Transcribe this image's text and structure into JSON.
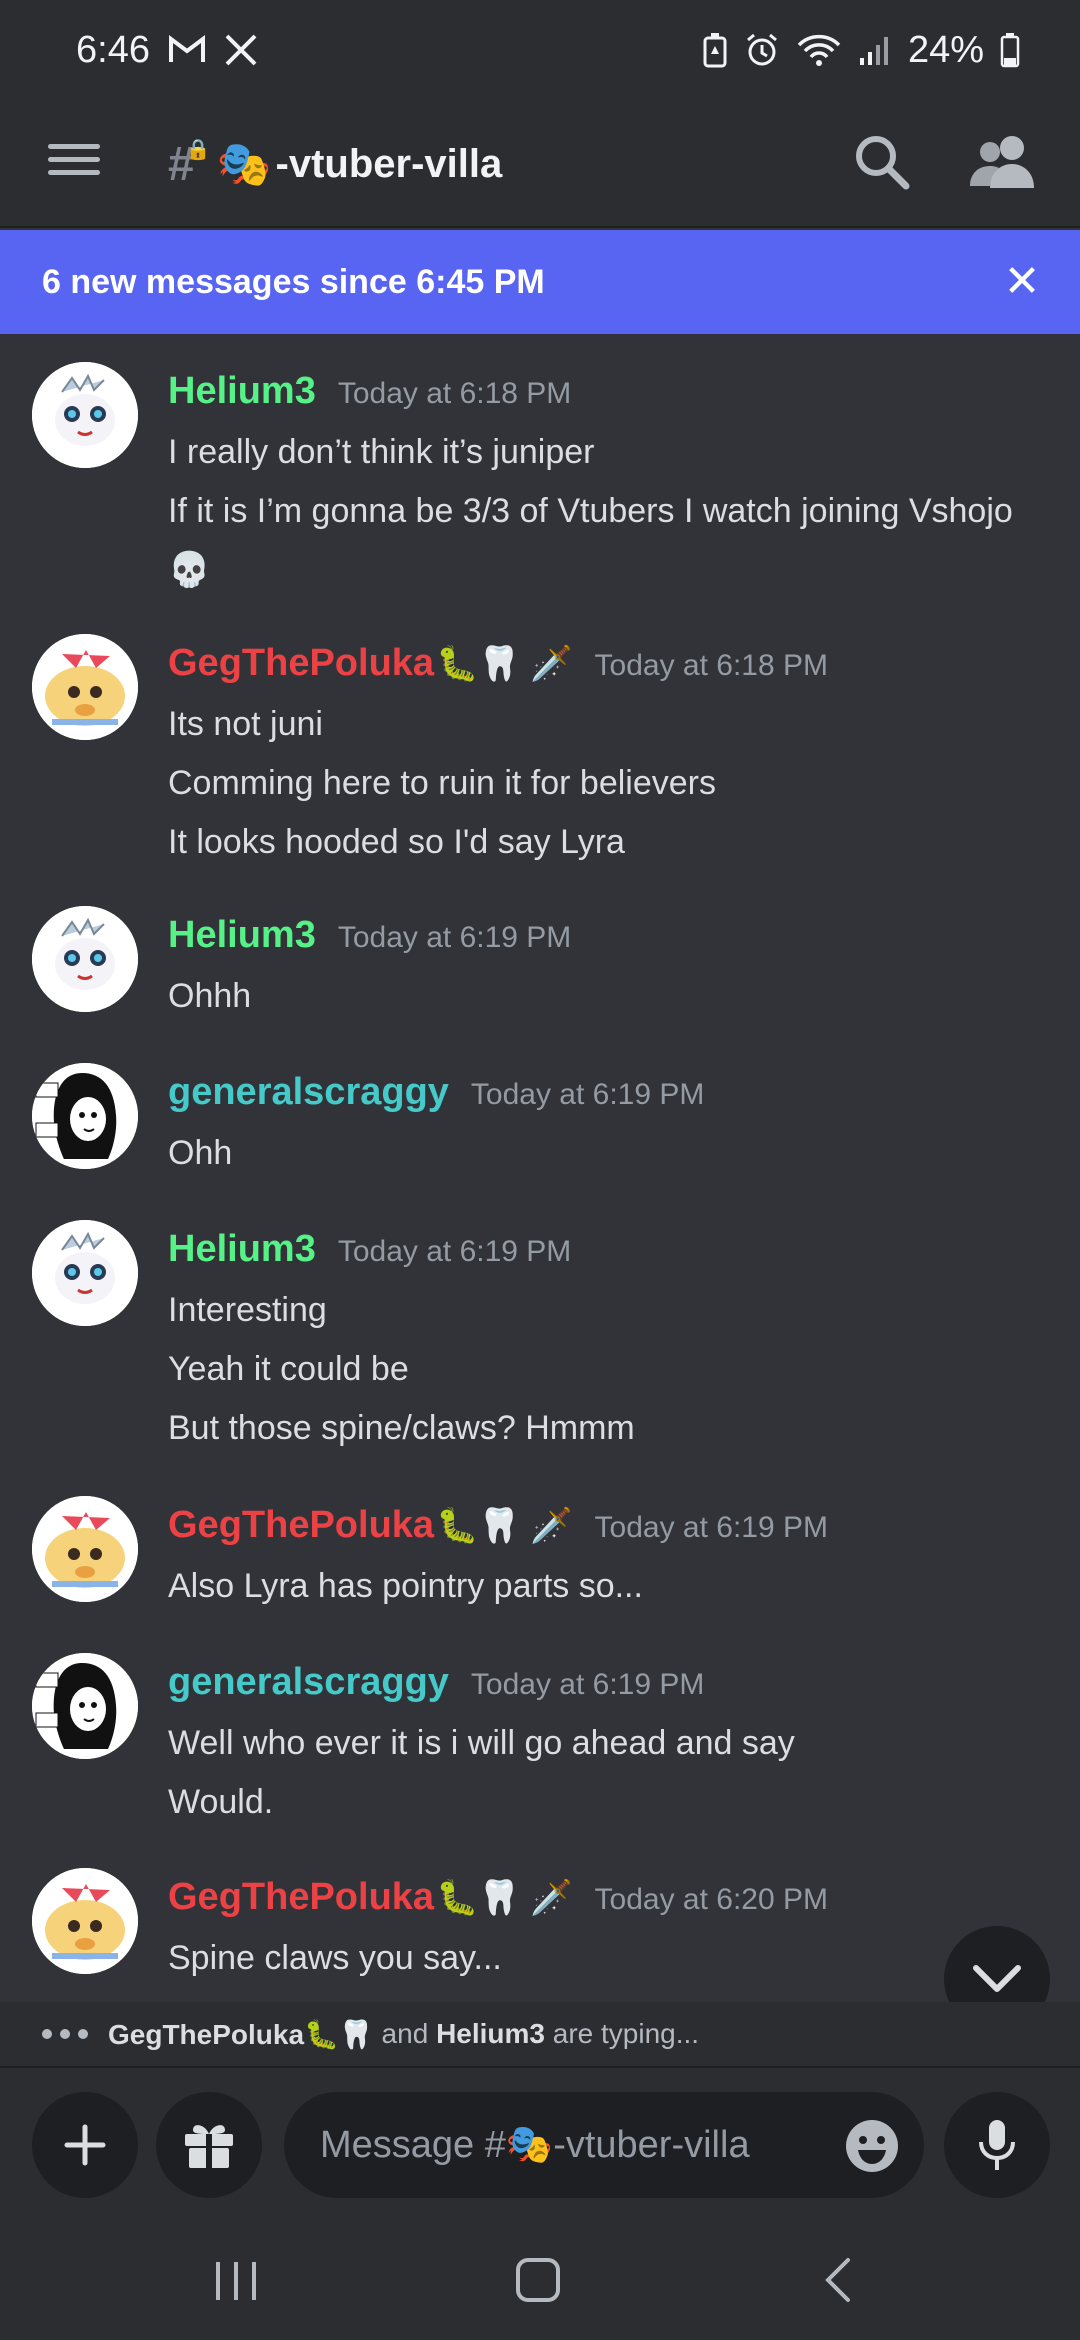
{
  "status_bar": {
    "time": "6:46",
    "battery": "24%"
  },
  "header": {
    "channel_prefix": "#",
    "channel_emoji": "🎭",
    "channel_name": "-vtuber-villa"
  },
  "banner": {
    "text": "6 new messages since 6:45 PM"
  },
  "messages": [
    {
      "user": "Helium3",
      "badges": "",
      "time": "Today at 6:18 PM",
      "lines": [
        "I really don’t think it’s juniper",
        "If it is I’m gonna be 3/3 of Vtubers I watch joining Vshojo",
        "💀"
      ]
    },
    {
      "user": "GegThePoluka",
      "badges": "🐛🦷 🗡️",
      "time": "Today at 6:18 PM",
      "lines": [
        "Its not juni",
        "Comming here to ruin it for believers",
        "It looks hooded so I'd say Lyra"
      ]
    },
    {
      "user": "Helium3",
      "badges": "",
      "time": "Today at 6:19 PM",
      "lines": [
        "Ohhh"
      ]
    },
    {
      "user": "generalscraggy",
      "badges": "",
      "time": "Today at 6:19 PM",
      "lines": [
        "Ohh"
      ]
    },
    {
      "user": "Helium3",
      "badges": "",
      "time": "Today at 6:19 PM",
      "lines": [
        "Interesting",
        "Yeah it could be",
        "But those spine/claws? Hmmm"
      ]
    },
    {
      "user": "GegThePoluka",
      "badges": "🐛🦷 🗡️",
      "time": "Today at 6:19 PM",
      "lines": [
        "Also Lyra has pointry parts so..."
      ]
    },
    {
      "user": "generalscraggy",
      "badges": "",
      "time": "Today at 6:19 PM",
      "lines": [
        "Well who ever it is i will go ahead and say",
        "Would."
      ]
    },
    {
      "user": "GegThePoluka",
      "badges": "🐛🦷 🗡️",
      "time": "Today at 6:20 PM",
      "lines": [
        "Spine claws you say..."
      ]
    }
  ],
  "typing": {
    "user1": "GegThePoluka🐛🦷",
    "conj": " and ",
    "user2": "Helium3",
    "suffix": " are typing..."
  },
  "composer": {
    "placeholder": "Message #🎭-vtuber-villa"
  },
  "colors": {
    "accent": "#5865f2",
    "helium": "#57f287",
    "geg": "#ed4245",
    "scraggy": "#45c9c9"
  }
}
